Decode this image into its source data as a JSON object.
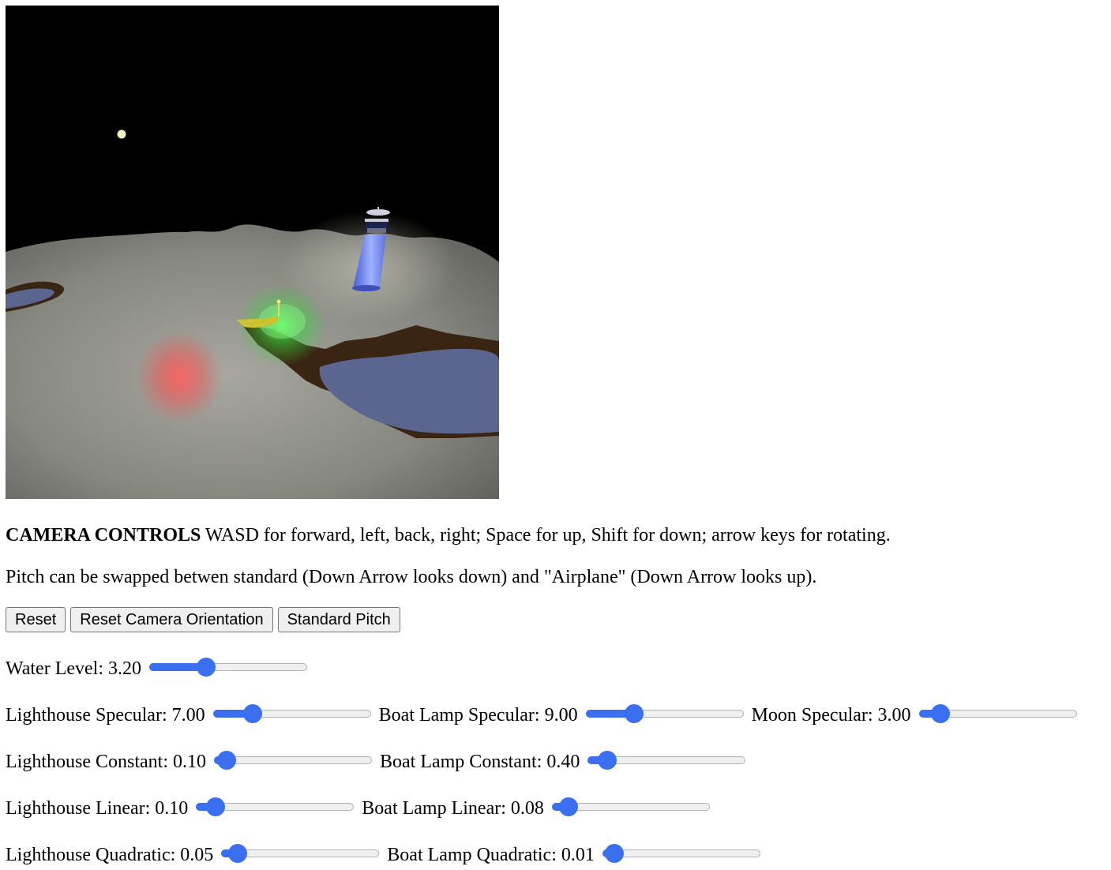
{
  "scene": {
    "colors": {
      "sky": "#000000",
      "terrain": "#8a8a82",
      "water": "#5a6690",
      "shadow": "#3a2412",
      "lighthouse": "#6f82e8",
      "moon": "#f4f0c8",
      "green_light": "#3bd23b",
      "red_light": "#ff4a4a",
      "boat": "#c9c232"
    }
  },
  "intro": {
    "heading": "CAMERA CONTROLS",
    "text": " WASD for forward, left, back, right; Space for up, Shift for down; arrow keys for rotating."
  },
  "pitch_note": "Pitch can be swapped betwen standard (Down Arrow looks down) and \"Airplane\" (Down Arrow looks up).",
  "buttons": {
    "reset": "Reset",
    "reset_camera": "Reset Camera Orientation",
    "pitch": "Standard Pitch"
  },
  "controls": {
    "water_level": {
      "label": "Water Level: 3.20",
      "value": 0.34
    },
    "lighthouse_specular": {
      "label": "Lighthouse Specular: 7.00",
      "value": 0.22
    },
    "boat_specular": {
      "label": "Boat Lamp Specular: 9.00",
      "value": 0.28
    },
    "moon_specular": {
      "label": "Moon Specular: 3.00",
      "value": 0.09
    },
    "lighthouse_constant": {
      "label": "Lighthouse Constant: 0.10",
      "value": 0.02
    },
    "boat_constant": {
      "label": "Boat Lamp Constant: 0.40",
      "value": 0.07
    },
    "lighthouse_linear": {
      "label": "Lighthouse Linear: 0.10",
      "value": 0.07
    },
    "boat_linear": {
      "label": "Boat Lamp Linear: 0.08",
      "value": 0.05
    },
    "lighthouse_quadratic": {
      "label": "Lighthouse Quadratic: 0.05",
      "value": 0.05
    },
    "boat_quadratic": {
      "label": "Boat Lamp Quadratic: 0.01",
      "value": 0.02
    }
  }
}
